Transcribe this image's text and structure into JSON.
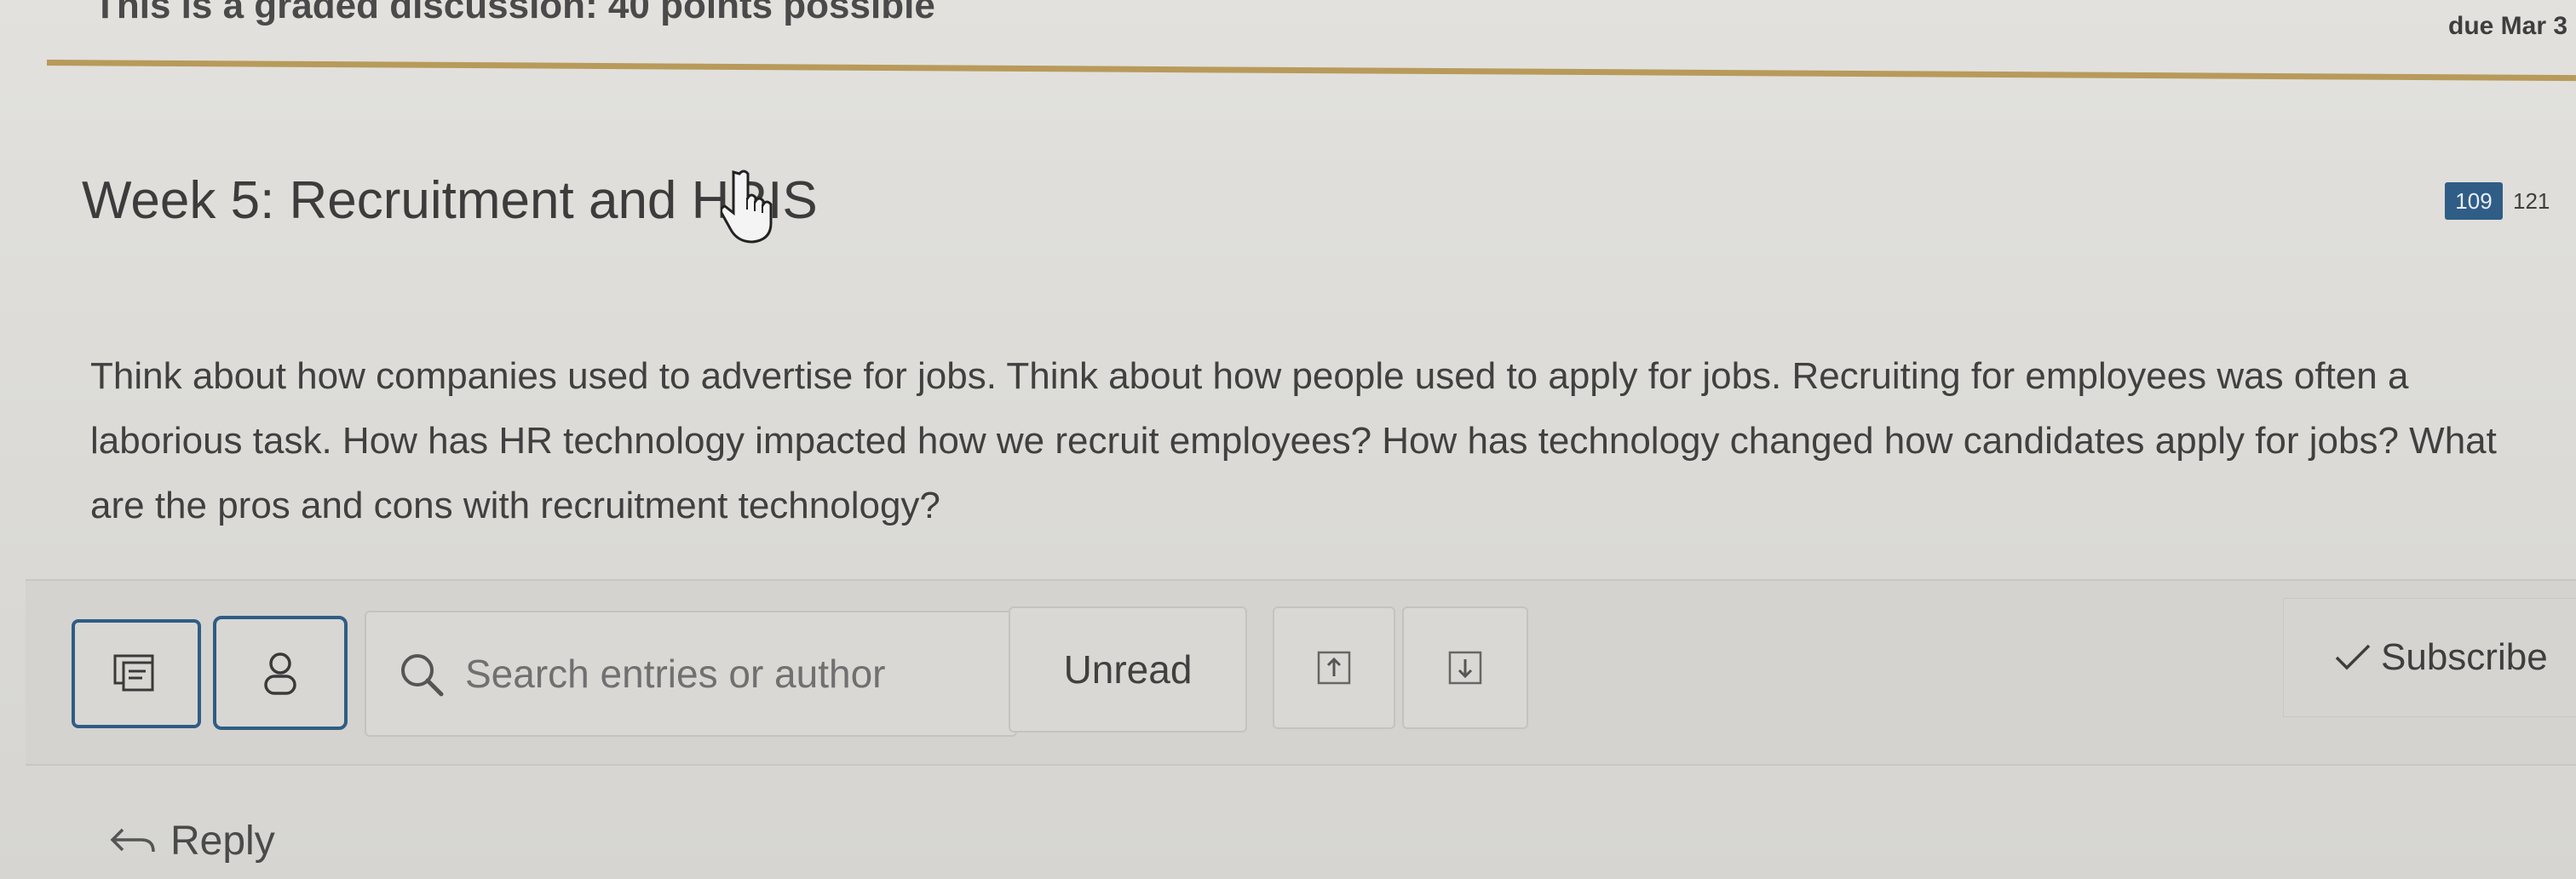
{
  "header": {
    "graded_note": "This is a graded discussion: 40 points possible",
    "due_date": "due Mar 3"
  },
  "topic": {
    "title": "Week 5: Recruitment and HRIS",
    "unread_count": "109",
    "total_count": "121",
    "prompt": "Think about how companies used to advertise for jobs. Think about how people used to apply for jobs. Recruiting for employees was often a laborious task. How has HR technology impacted how we recruit employees? How has technology changed how candidates apply for jobs? What are the pros and cons with recruitment technology?"
  },
  "toolbar": {
    "collapse_icon": "collapse-replies-icon",
    "author_icon": "person-icon",
    "search_placeholder": "Search entries or author",
    "unread_label": "Unread",
    "up_icon": "arrow-up-icon",
    "down_icon": "arrow-down-icon",
    "subscribe_label": "Subscribe"
  },
  "reply": {
    "label": "Reply"
  },
  "colors": {
    "accent": "#2f5d86",
    "divider": "#b89a5a",
    "background": "#dddcd8"
  }
}
